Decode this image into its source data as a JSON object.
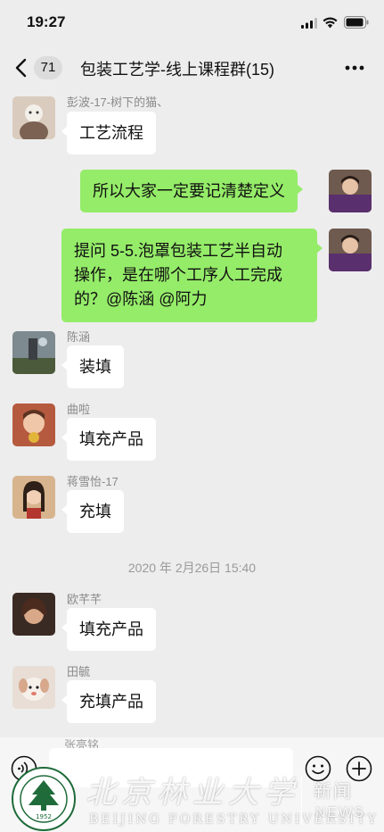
{
  "status_bar": {
    "time": "19:27"
  },
  "nav": {
    "unread_count": "71",
    "title": "包装工艺学-线上课程群(15)"
  },
  "messages": [
    {
      "sender": "彭波-17-树下的猫、",
      "text": "工艺流程"
    },
    {
      "sender": "",
      "text": "所以大家一定要记清楚定义"
    },
    {
      "sender": "",
      "lines": [
        "提问 5-5.泡罩包装工艺半自动",
        "操作，是在哪个工序人工完成",
        "的？@陈涵 @阿力"
      ]
    },
    {
      "sender": "陈涵",
      "text": "装填"
    },
    {
      "sender": "曲啦",
      "text": "填充产品"
    },
    {
      "sender": "蒋雪怡-17",
      "text": "充填"
    },
    {
      "sender": "欧芊芊",
      "text": "填充产品"
    },
    {
      "sender": "田毓",
      "text": "充填产品"
    }
  ],
  "time_divider": "2020 年 2月26日 15:40",
  "partial_sender": "张亮铭",
  "watermark": {
    "script": "北京林业大学",
    "english": "BEIJING FORESTRY UNIVERSITY",
    "news_cn": "新闻",
    "news_en": "NEWS",
    "seal_year": "1952",
    "seal_text": "BEIJING FORESTRY UNIVERSITY"
  },
  "colors": {
    "background": "#ededed",
    "outgoing_bubble": "#95ec69",
    "incoming_bubble": "#ffffff",
    "seal": "#1f6b3a"
  }
}
